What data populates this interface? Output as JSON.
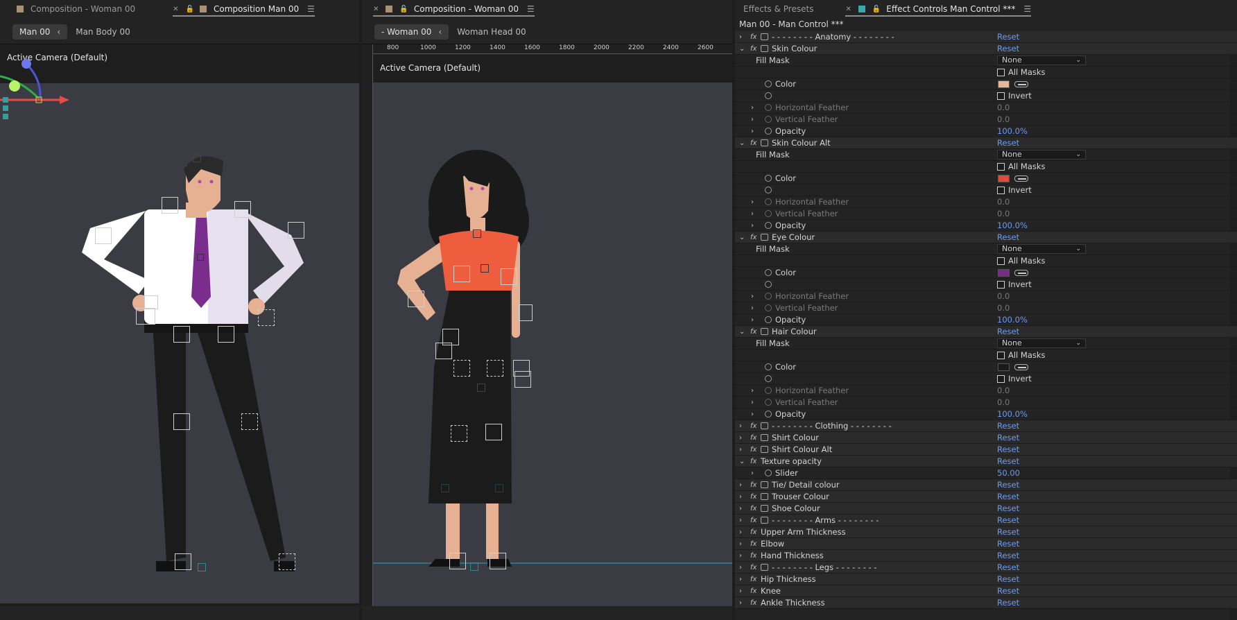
{
  "left_panel": {
    "tabs": [
      {
        "label": "Composition - Woman 00",
        "active": false
      },
      {
        "label": "Composition Man 00",
        "active": true
      }
    ],
    "crumb_active": "Man 00",
    "crumb_next": "Man Body 00",
    "camera_label": "Active Camera (Default)"
  },
  "mid_panel": {
    "tab": {
      "label": "Composition - Woman 00",
      "active": true
    },
    "crumb_active": "- Woman 00",
    "crumb_next": "Woman Head 00",
    "camera_label": "Active Camera (Default)",
    "ruler_ticks": [
      "800",
      "1000",
      "1200",
      "1400",
      "1600",
      "1800",
      "2000",
      "2200",
      "2400",
      "2600"
    ]
  },
  "right_panel": {
    "tabs": [
      {
        "label": "Effects & Presets",
        "active": false
      },
      {
        "label": "Effect Controls Man Control ***",
        "active": true
      }
    ],
    "title": "Man 00 - Man Control ***",
    "reset_label": "Reset",
    "effects": {
      "anatomy": "- - - - - - - - Anatomy - - - - - - - -",
      "skin": "Skin Colour",
      "skin_alt": "Skin Colour Alt",
      "eye": "Eye Colour",
      "hair": "Hair Colour",
      "clothing": "- - - - - - - - Clothing - - - - - - - -",
      "shirt": "Shirt Colour",
      "shirt_alt": "Shirt Colour Alt",
      "texture": "Texture opacity",
      "tie": "Tie/ Detail colour",
      "trouser": "Trouser Colour",
      "shoe": "Shoe Colour",
      "arms": "- - - - - - - - Arms - - - - - - - -",
      "upper_arm": "Upper Arm Thickness",
      "elbow": "Elbow",
      "hand": "Hand Thickness",
      "legs": "- - - - - - - - Legs - - - - - - - -",
      "hip": "Hip Thickness",
      "knee": "Knee",
      "ankle": "Ankle Thickness"
    },
    "props": {
      "fill_mask": "Fill Mask",
      "none": "None",
      "all_masks": "All Masks",
      "color": "Color",
      "invert": "Invert",
      "h_feather": "Horizontal Feather",
      "v_feather": "Vertical Feather",
      "opacity": "Opacity",
      "zero": "0.0",
      "opacity_val": "100.0%",
      "slider": "Slider",
      "slider_val": "50.00"
    },
    "colors": {
      "skin": "#e8b49a",
      "skin_alt": "#e24b3b",
      "eye": "#7a2a8a",
      "hair": "#1a1a1a",
      "accent": "#6a9cf7"
    }
  }
}
